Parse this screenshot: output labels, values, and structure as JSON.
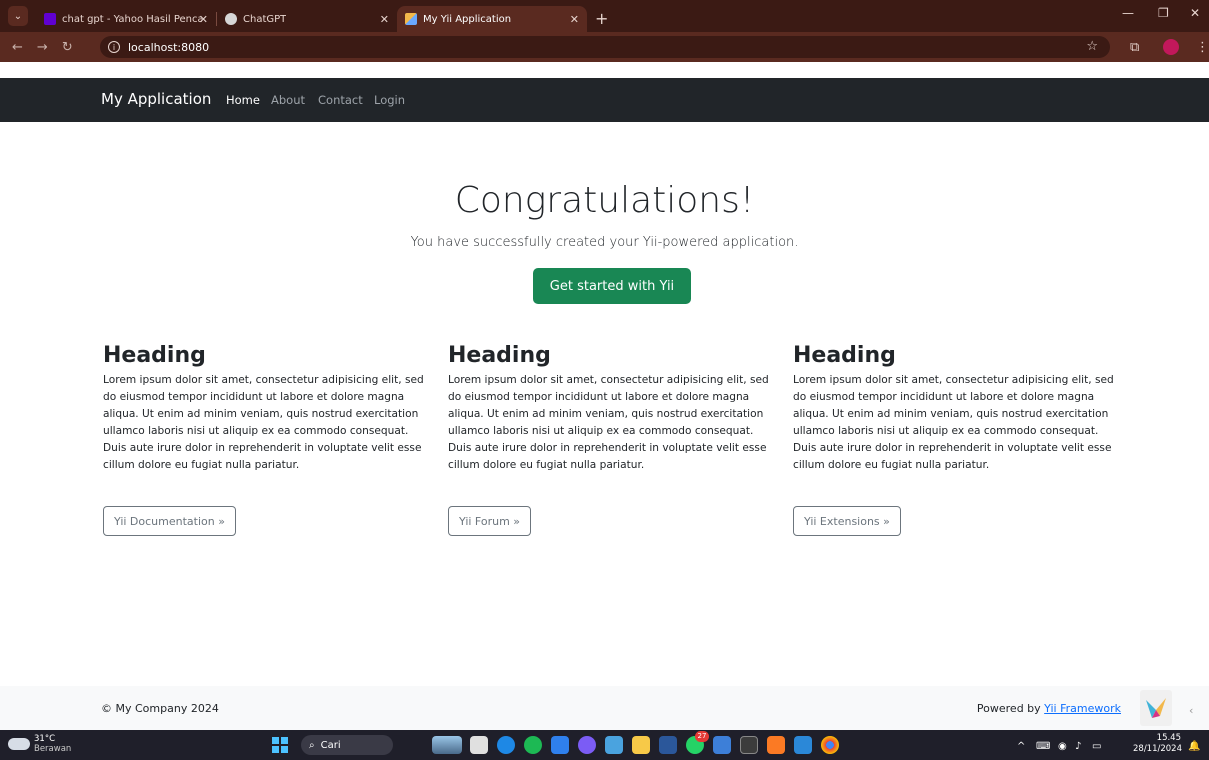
{
  "browser": {
    "tabs": [
      {
        "title": "chat gpt - Yahoo Hasil Pencarian",
        "favicon_color": "#6001d2"
      },
      {
        "title": "ChatGPT",
        "favicon_color": "#d6d6d6"
      },
      {
        "title": "My Yii Application",
        "favicon_color": "#f2b84b"
      }
    ],
    "url": "localhost:8080",
    "new_tab": "+"
  },
  "navbar": {
    "brand": "My Application",
    "links": [
      "Home",
      "About",
      "Contact",
      "Login"
    ]
  },
  "hero": {
    "title": "Congratulations!",
    "lead": "You have successfully created your Yii-powered application.",
    "button": "Get started with Yii"
  },
  "columns": [
    {
      "heading": "Heading",
      "text": "Lorem ipsum dolor sit amet, consectetur adipisicing elit, sed do eiusmod tempor incididunt ut labore et dolore magna aliqua. Ut enim ad minim veniam, quis nostrud exercitation ullamco laboris nisi ut aliquip ex ea commodo consequat. Duis aute irure dolor in reprehenderit in voluptate velit esse cillum dolore eu fugiat nulla pariatur.",
      "button": "Yii Documentation »"
    },
    {
      "heading": "Heading",
      "text": "Lorem ipsum dolor sit amet, consectetur adipisicing elit, sed do eiusmod tempor incididunt ut labore et dolore magna aliqua. Ut enim ad minim veniam, quis nostrud exercitation ullamco laboris nisi ut aliquip ex ea commodo consequat. Duis aute irure dolor in reprehenderit in voluptate velit esse cillum dolore eu fugiat nulla pariatur.",
      "button": "Yii Forum »"
    },
    {
      "heading": "Heading",
      "text": "Lorem ipsum dolor sit amet, consectetur adipisicing elit, sed do eiusmod tempor incididunt ut labore et dolore magna aliqua. Ut enim ad minim veniam, quis nostrud exercitation ullamco laboris nisi ut aliquip ex ea commodo consequat. Duis aute irure dolor in reprehenderit in voluptate velit esse cillum dolore eu fugiat nulla pariatur.",
      "button": "Yii Extensions »"
    }
  ],
  "footer": {
    "copyright": "© My Company 2024",
    "powered_prefix": "Powered by ",
    "powered_link": "Yii Framework"
  },
  "taskbar": {
    "temperature": "31°C",
    "weather": "Berawan",
    "search_placeholder": "Cari",
    "time": "15.45",
    "date": "28/11/2024",
    "badge_count": "27"
  },
  "colors": {
    "navbar_bg": "#212529",
    "primary_button": "#198754",
    "link": "#0d6efd"
  }
}
